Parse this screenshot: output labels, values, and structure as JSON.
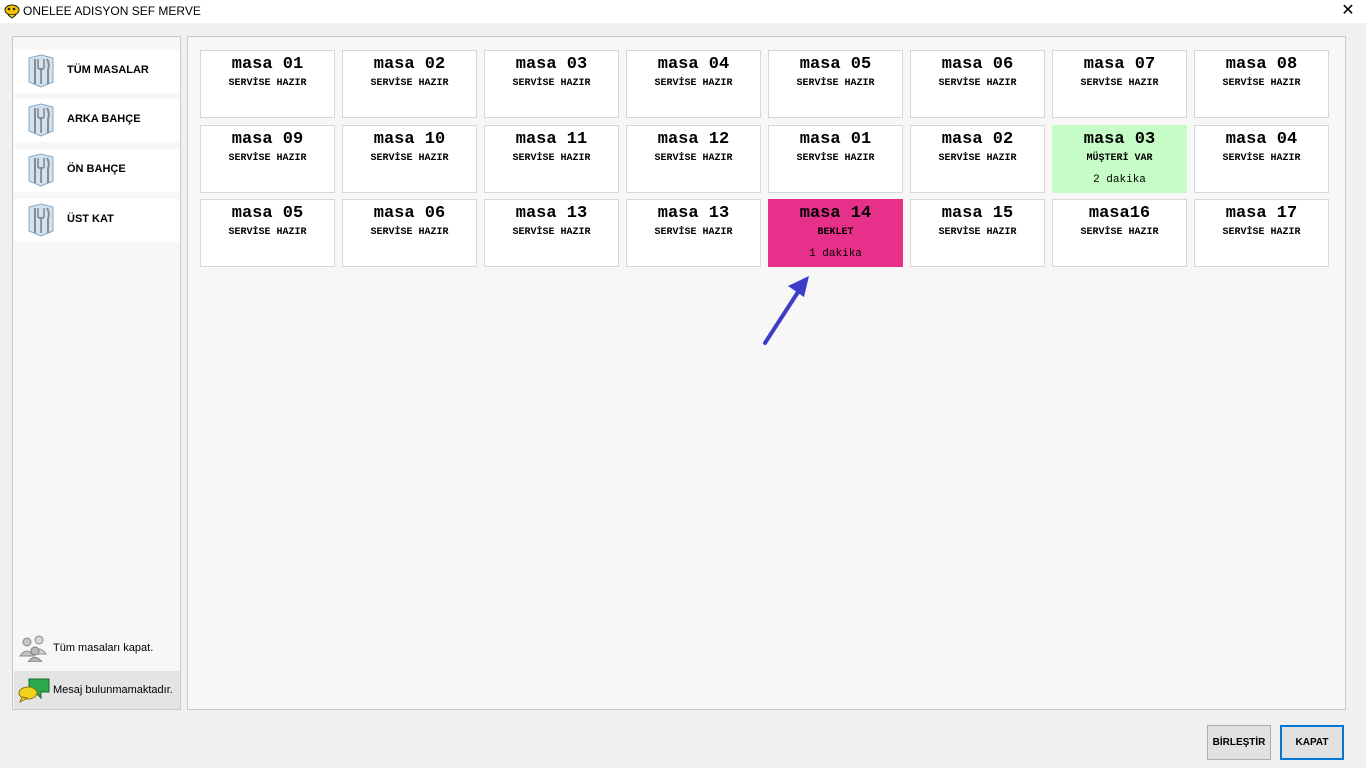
{
  "window": {
    "title": "ONELEE ADISYON SEF MERVE",
    "close_label": "✕"
  },
  "sidebar": {
    "items": [
      {
        "label": "TÜM MASALAR"
      },
      {
        "label": "ARKA BAHÇE"
      },
      {
        "label": "ÖN BAHÇE"
      },
      {
        "label": "ÜST KAT"
      }
    ],
    "close_all_label": "Tüm masaları kapat.",
    "message_label": "Mesaj bulunmamaktadır."
  },
  "tables": [
    {
      "name": "masa 01",
      "status": "SERVİSE HAZIR",
      "time": ""
    },
    {
      "name": "masa 02",
      "status": "SERVİSE HAZIR",
      "time": ""
    },
    {
      "name": "masa 03",
      "status": "SERVİSE HAZIR",
      "time": ""
    },
    {
      "name": "masa 04",
      "status": "SERVİSE HAZIR",
      "time": ""
    },
    {
      "name": "masa 05",
      "status": "SERVİSE HAZIR",
      "time": ""
    },
    {
      "name": "masa 06",
      "status": "SERVİSE HAZIR",
      "time": ""
    },
    {
      "name": "masa 07",
      "status": "SERVİSE HAZIR",
      "time": ""
    },
    {
      "name": "masa 08",
      "status": "SERVİSE HAZIR",
      "time": ""
    },
    {
      "name": "masa 09",
      "status": "SERVİSE HAZIR",
      "time": ""
    },
    {
      "name": "masa 10",
      "status": "SERVİSE HAZIR",
      "time": ""
    },
    {
      "name": "masa 11",
      "status": "SERVİSE HAZIR",
      "time": ""
    },
    {
      "name": "masa 12",
      "status": "SERVİSE HAZIR",
      "time": ""
    },
    {
      "name": "masa 01",
      "status": "SERVİSE HAZIR",
      "time": ""
    },
    {
      "name": "masa 02",
      "status": "SERVİSE HAZIR",
      "time": ""
    },
    {
      "name": "masa 03",
      "status": "MÜŞTERİ VAR",
      "time": "2 dakika"
    },
    {
      "name": "masa 04",
      "status": "SERVİSE HAZIR",
      "time": ""
    },
    {
      "name": "masa 05",
      "status": "SERVİSE HAZIR",
      "time": ""
    },
    {
      "name": "masa 06",
      "status": "SERVİSE HAZIR",
      "time": ""
    },
    {
      "name": "masa 13",
      "status": "SERVİSE HAZIR",
      "time": ""
    },
    {
      "name": "masa 13",
      "status": "SERVİSE HAZIR",
      "time": ""
    },
    {
      "name": "masa 14",
      "status": "BEKLET",
      "time": "1 dakika"
    },
    {
      "name": "masa 15",
      "status": "SERVİSE HAZIR",
      "time": ""
    },
    {
      "name": "masa16",
      "status": "SERVİSE HAZIR",
      "time": ""
    },
    {
      "name": "masa 17",
      "status": "SERVİSE HAZIR",
      "time": ""
    }
  ],
  "status_colors": {
    "SERVİSE HAZIR": "#ffffff",
    "MÜŞTERİ VAR": "#c6fcc6",
    "BEKLET": "#e7308a"
  },
  "buttons": {
    "merge_label": "BİRLEŞTİR",
    "close_label": "KAPAT"
  },
  "arrow_color": "#3c3cc8"
}
